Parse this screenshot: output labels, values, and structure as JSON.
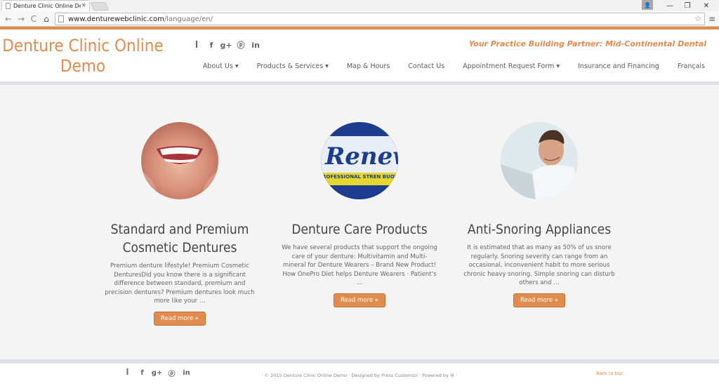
{
  "browser": {
    "tab_title": "Denture Clinic Online Dem",
    "tab_close": "×",
    "url_host": "www.denturewebclinic.com",
    "url_path": "/language/en/",
    "win_min": "—",
    "win_restore": "❐",
    "win_close": "✕",
    "back": "←",
    "forward": "→",
    "reload": "C",
    "home": "⌂",
    "star": "☆",
    "menu": "≡",
    "user": "👤"
  },
  "header": {
    "brand": "Denture Clinic Online Demo",
    "tagline": "Your Practice Building Partner: Mid-Continental Dental",
    "social_icons": [
      "rss-icon",
      "facebook-icon",
      "google-plus-icon",
      "pinterest-icon",
      "linkedin-icon"
    ],
    "social_glyphs": [
      "ꟾ",
      "f",
      "g+",
      "ⓟ",
      "in"
    ],
    "nav": [
      {
        "label": "About Us ▾"
      },
      {
        "label": "Products & Services ▾"
      },
      {
        "label": "Map & Hours"
      },
      {
        "label": "Contact Us"
      },
      {
        "label": "Appointment Request Form ▾"
      },
      {
        "label": "Insurance and Financing"
      },
      {
        "label": "Français"
      }
    ]
  },
  "features": [
    {
      "title": "Standard and Premium Cosmetic Dentures",
      "text": "Premium denture lifestyle!   Premium Cosmetic DenturesDid you know there is a significant difference between standard, premium and precision dentures?  Premium dentures look much more like your …",
      "button": "Read more »"
    },
    {
      "title": "Denture Care Products",
      "text": "We have several products that support the ongoing care of your denture: Multivitamin and Multi-mineral for Denture Wearers – Brand New Product!     How OnePro Diet helps Denture Wearers ·  Patient's …",
      "button": "Read more »",
      "image_text": "Renew",
      "image_band": "ROFESSIONAL STREN BUOYANT PROFESSI"
    },
    {
      "title": "Anti-Snoring Appliances",
      "text": "It is estimated that as many as 50% of us snore regularly. Snoring severity can range from an occasional, inconvenient habit to more serious chronic heavy snoring. Simple snoring can disturb others and …",
      "button": "Read more »"
    }
  ],
  "footer": {
    "credits": "· © 2015 Denture Clinic Online Demo · Designed by Press Customizr · Powered by Ⓦ ·",
    "back_to_top": "Back to top"
  },
  "colors": {
    "accent": "#e08c4f",
    "text": "#444444",
    "background": "#f4f4f4"
  }
}
